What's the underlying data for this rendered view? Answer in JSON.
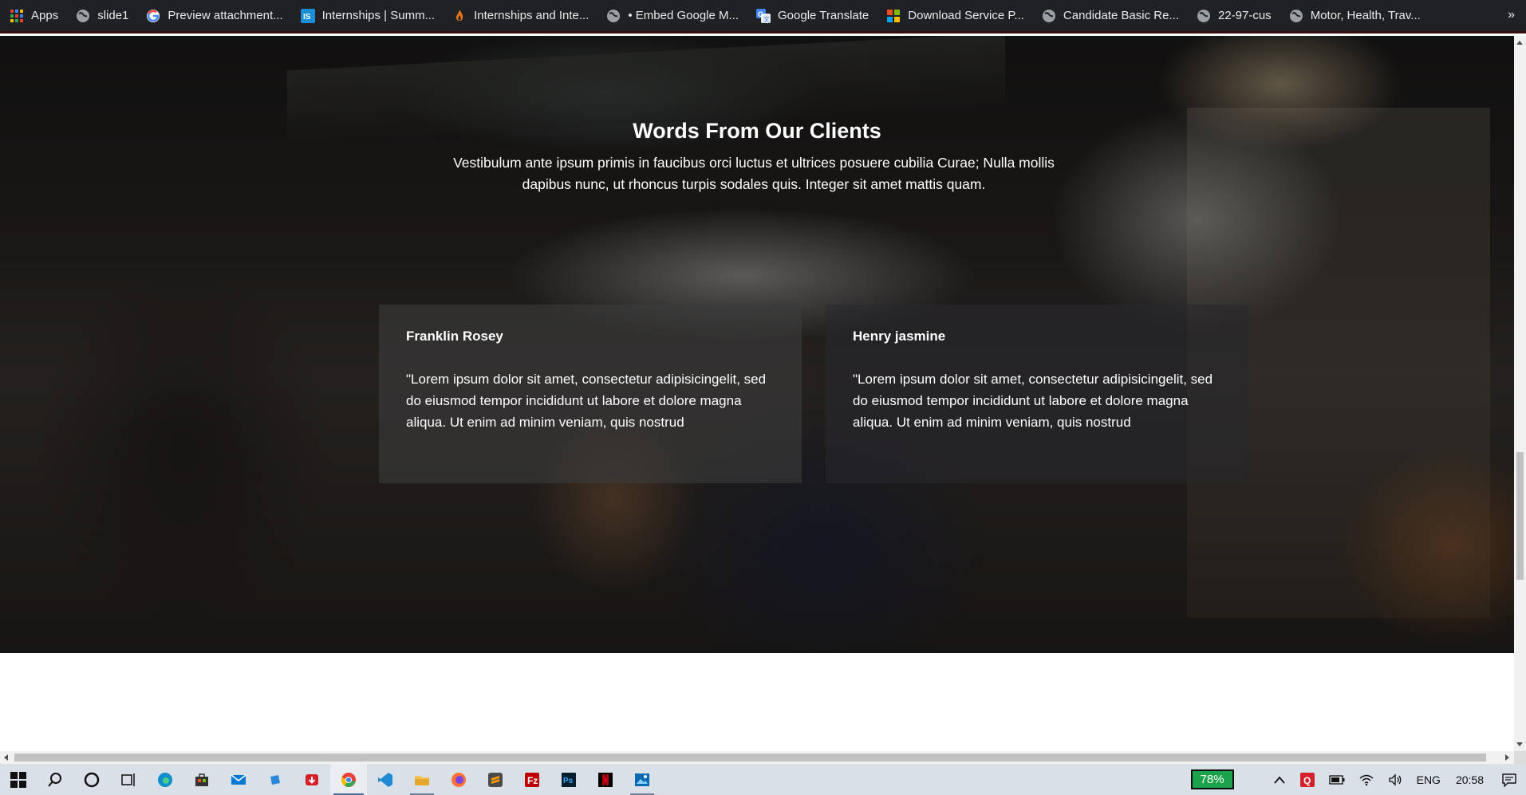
{
  "bookmarks": [
    {
      "label": "Apps",
      "icon": "apps-grid-icon"
    },
    {
      "label": "slide1",
      "icon": "globe-icon"
    },
    {
      "label": "Preview attachment...",
      "icon": "google-icon"
    },
    {
      "label": "Internships | Summ...",
      "icon": "is-logo-icon"
    },
    {
      "label": "Internships and Inte...",
      "icon": "flame-icon"
    },
    {
      "label": "• Embed Google M...",
      "icon": "globe-icon"
    },
    {
      "label": "Google Translate",
      "icon": "translate-icon"
    },
    {
      "label": "Download Service P...",
      "icon": "microsoft-icon"
    },
    {
      "label": "Candidate Basic Re...",
      "icon": "globe-icon"
    },
    {
      "label": "22-97-cus",
      "icon": "globe-icon"
    },
    {
      "label": "Motor, Health, Trav...",
      "icon": "globe-icon"
    }
  ],
  "bookmarks_more": "»",
  "section": {
    "title": "Words From Our Clients",
    "subtitle": "Vestibulum ante ipsum primis in faucibus orci luctus et ultrices posuere cubilia Curae; Nulla mollis dapibus nunc, ut rhoncus turpis sodales quis. Integer sit amet mattis quam."
  },
  "testimonials": [
    {
      "name": "Franklin Rosey",
      "quote": "\"Lorem ipsum dolor sit amet, consectetur adipisicingelit, sed do eiusmod tempor incididunt ut labore et dolore magna aliqua. Ut enim ad minim veniam, quis nostrud"
    },
    {
      "name": "Henry jasmine",
      "quote": "\"Lorem ipsum dolor sit amet, consectetur adipisicingelit, sed do eiusmod tempor incididunt ut labore et dolore magna aliqua. Ut enim ad minim veniam, quis nostrud"
    }
  ],
  "taskbar": {
    "apps": [
      "windows-start-icon",
      "search-icon",
      "cortana-icon",
      "task-view-icon",
      "edge-icon",
      "store-icon",
      "mail-icon",
      "files-icon",
      "download-icon",
      "chrome-icon",
      "vscode-icon",
      "file-explorer-icon",
      "firefox-icon",
      "sublime-icon",
      "filezilla-icon",
      "photoshop-icon",
      "netflix-icon",
      "photos-icon"
    ]
  },
  "tray": {
    "battery_percent": "78%",
    "language": "ENG",
    "time": "20:58"
  }
}
